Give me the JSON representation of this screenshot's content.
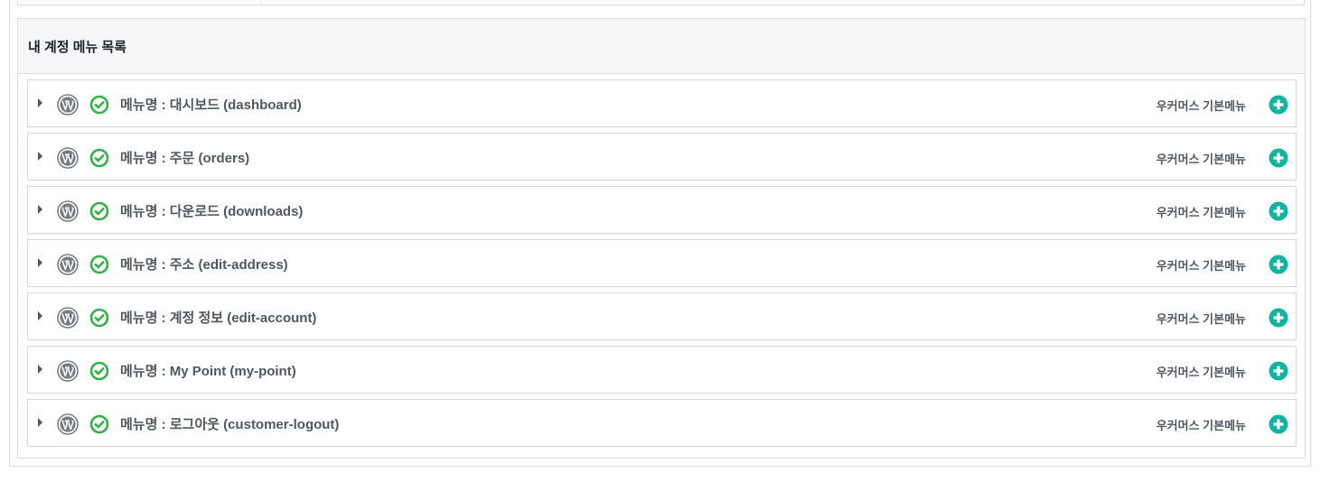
{
  "panel": {
    "title": "내 계정 메뉴 목록"
  },
  "menu_items": [
    {
      "label": "메뉴명 : 대시보드 (dashboard)",
      "type": "우커머스 기본메뉴"
    },
    {
      "label": "메뉴명 : 주문 (orders)",
      "type": "우커머스 기본메뉴"
    },
    {
      "label": "메뉴명 : 다운로드 (downloads)",
      "type": "우커머스 기본메뉴"
    },
    {
      "label": "메뉴명 : 주소 (edit-address)",
      "type": "우커머스 기본메뉴"
    },
    {
      "label": "메뉴명 : 계정 정보 (edit-account)",
      "type": "우커머스 기본메뉴"
    },
    {
      "label": "메뉴명 : My Point (my-point)",
      "type": "우커머스 기본메뉴"
    },
    {
      "label": "메뉴명 : 로그아웃 (customer-logout)",
      "type": "우커머스 기본메뉴"
    }
  ],
  "icons": {
    "expand": "caret-right-icon",
    "platform": "wordpress-icon",
    "status": "check-circle-icon",
    "add": "plus-circle-icon"
  },
  "colors": {
    "status_green": "#2fb344",
    "add_teal": "#12b3a0",
    "wordpress_gray": "#787c82"
  }
}
